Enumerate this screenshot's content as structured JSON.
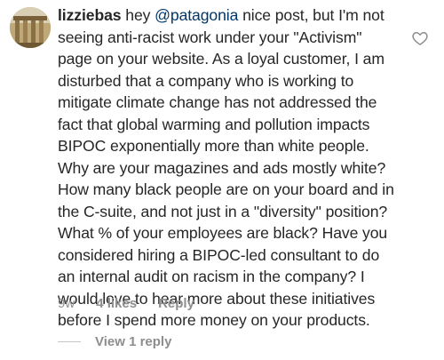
{
  "comment": {
    "username": "lizziebas",
    "text_before_mention": "hey ",
    "mention": "@patagonia",
    "text_after_mention": " nice post, but I'm not seeing anti-racist work under your \"Activism\" page on your website. As a loyal customer, I am disturbed that a company who is working to mitigate climate change has not addressed the fact that global warming and pollution impacts BIPOC exponentially more than white people. Why are your magazines and ads mostly white? How many black people are on your board and in the C-suite, and not just in a \"diversity\" position? What % of your employees are black? Have you considered hiring a BIPOC-led consultant to do an internal audit on racism in the company? I would love to hear more about these initiatives before I spend more money on your products."
  },
  "meta": {
    "age": "9w",
    "likes": "4 likes",
    "reply_label": "Reply"
  },
  "replies": {
    "view_label": "View 1 reply"
  },
  "icons": {
    "like": "heart-outline-icon",
    "avatar": "profile-avatar"
  },
  "colors": {
    "text": "#262626",
    "secondary": "#8e8e8e",
    "mention": "#00376b"
  }
}
